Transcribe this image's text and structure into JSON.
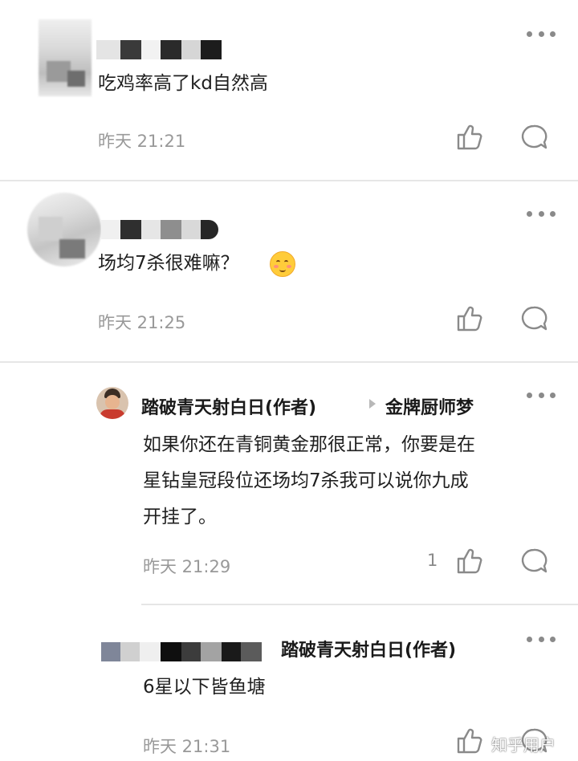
{
  "comments": [
    {
      "content": "吃鸡率高了kd自然高",
      "time": "昨天 21:21"
    },
    {
      "content": "场均7杀很难嘛？",
      "emoji": "smiling-face-with-hands-icon",
      "time": "昨天 21:25"
    }
  ],
  "replies": [
    {
      "author": "踏破青天射白日(作者)",
      "reply_to": "金牌厨师梦",
      "content_lines": [
        "如果你还在青铜黄金那很正常，你要是在",
        "星钻皇冠段位还场均7杀我可以说你九成",
        "开挂了。"
      ],
      "time": "昨天 21:29",
      "like_count": "1"
    },
    {
      "reply_to_name": "踏破青天射白日(作者)",
      "content": "6星以下皆鱼塘",
      "time": "昨天 21:31"
    }
  ],
  "watermark": "知乎用户",
  "colors": {
    "separator": "#e6e6e6",
    "meta_text": "#999999",
    "icon": "#8a8a8a"
  }
}
